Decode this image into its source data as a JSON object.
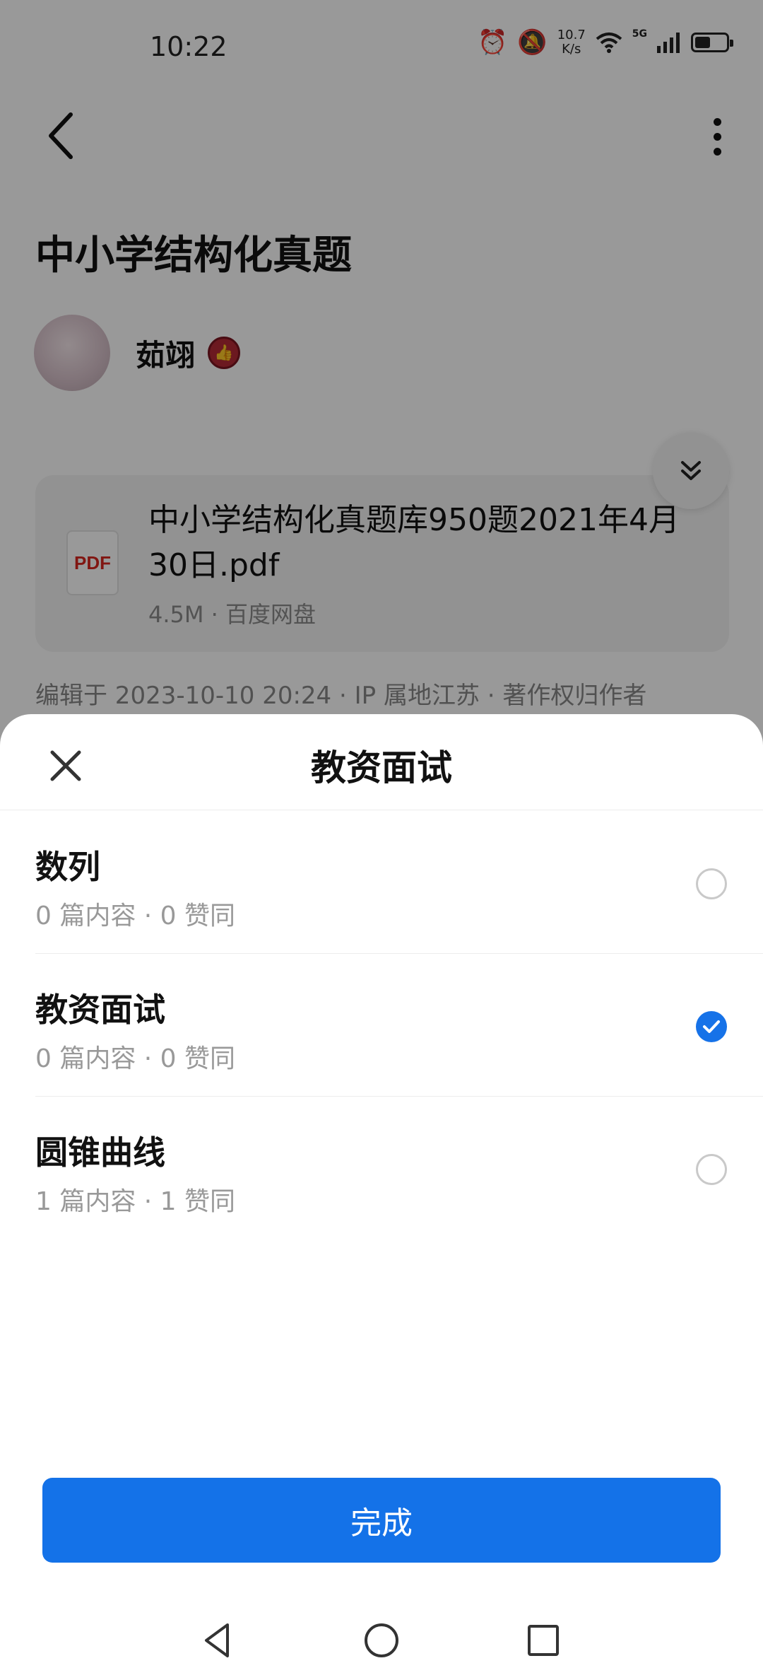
{
  "status_bar": {
    "time": "10:22",
    "net_speed_value": "10.7",
    "net_speed_unit": "K/s",
    "network_label": "5G",
    "battery_level": 0.5,
    "icons": [
      "alarm-icon",
      "mute-icon",
      "wifi-icon",
      "signal-icon",
      "battery-icon"
    ]
  },
  "top_bar": {
    "back_icon": "back-arrow-icon",
    "more_icon": "more-vertical-icon"
  },
  "post": {
    "title": "中小学结构化真题",
    "author_name": "茹翊",
    "badge_icon": "thumbs-up-badge-icon"
  },
  "file": {
    "type_label": "PDF",
    "name": "中小学结构化真题库950题2021年4月30日.pdf",
    "meta": "4.5M · 百度网盘"
  },
  "background_text": "编辑于 2023-10-10 20:24 · IP 属地江苏 · 著作权归作者",
  "sheet": {
    "title": "教资面试",
    "close_icon": "close-icon",
    "options": [
      {
        "name": "数列",
        "meta": "0 篇内容 · 0 赞同",
        "selected": false
      },
      {
        "name": "教资面试",
        "meta": "0 篇内容 · 0 赞同",
        "selected": true
      },
      {
        "name": "圆锥曲线",
        "meta": "1 篇内容 · 1 赞同",
        "selected": false
      }
    ],
    "done_label": "完成"
  },
  "colors": {
    "accent": "#1472e8",
    "overlay": "rgba(0,0,0,0.40)"
  }
}
